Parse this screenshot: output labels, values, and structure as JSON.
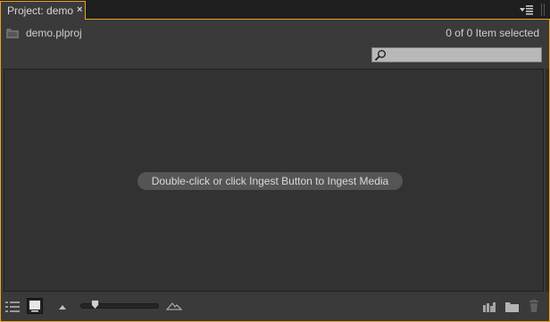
{
  "tab": {
    "label": "Project: demo",
    "close_glyph": "×"
  },
  "header": {
    "project_name": "demo.plproj",
    "selection_status": "0 of 0 Item selected"
  },
  "search": {
    "value": "",
    "placeholder": ""
  },
  "content": {
    "empty_hint": "Double-click or click Ingest Button to Ingest Media"
  },
  "toolbar": {
    "icons": {
      "list_view": "list-view-icon",
      "icon_view": "icon-view-icon",
      "zoom_out": "small-mountain-icon",
      "zoom_in": "large-mountain-icon",
      "automate": "automate-to-sequence-icon",
      "new_bin": "folder-icon",
      "delete": "trash-icon"
    },
    "zoom_level": 0.15
  },
  "colors": {
    "accent": "#e9a321",
    "panel_bg": "#3a3a3a",
    "content_bg": "#323232",
    "hint_bg": "#555555",
    "text": "#cfcfcf"
  }
}
